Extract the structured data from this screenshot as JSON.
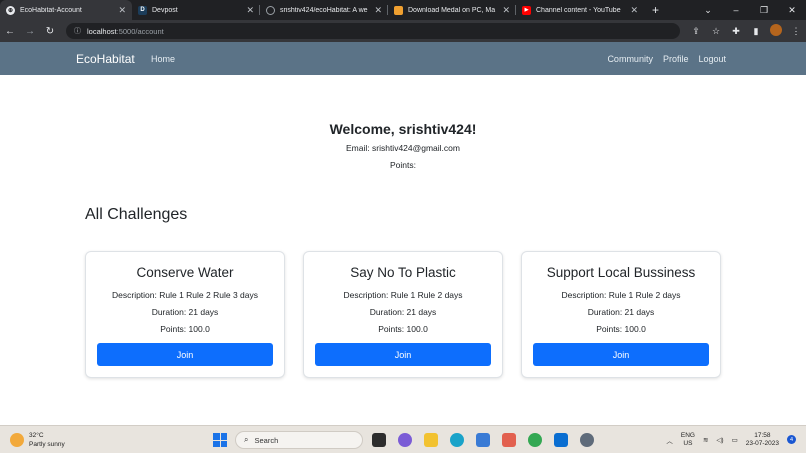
{
  "browser": {
    "tabs": [
      {
        "title": "EcoHabitat-Account",
        "active": true,
        "icon": "globe-icon"
      },
      {
        "title": "Devpost",
        "active": false,
        "icon": "devpost-icon"
      },
      {
        "title": "srishtiv424/ecoHabitat: A we",
        "active": false,
        "icon": "github-icon"
      },
      {
        "title": "Download Medal on PC, Ma",
        "active": false,
        "icon": "medal-icon"
      },
      {
        "title": "Channel content - YouTube",
        "active": false,
        "icon": "youtube-icon"
      }
    ],
    "new_tab": "+",
    "address": {
      "host": "localhost",
      "path": ":5000/account"
    }
  },
  "navbar": {
    "brand": "EcoHabitat",
    "home": "Home",
    "community": "Community",
    "profile": "Profile",
    "logout": "Logout"
  },
  "profile": {
    "welcome": "Welcome, srishtiv424!",
    "email": "Email: srishtiv424@gmail.com",
    "points": "Points:"
  },
  "section_title": "All Challenges",
  "challenges": [
    {
      "title": "Conserve Water",
      "description": "Description: Rule 1 Rule 2 Rule 3 days",
      "duration": "Duration: 21 days",
      "points": "Points: 100.0",
      "button": "Join"
    },
    {
      "title": "Say No To Plastic",
      "description": "Description: Rule 1 Rule 2 days",
      "duration": "Duration: 21 days",
      "points": "Points: 100.0",
      "button": "Join"
    },
    {
      "title": "Support Local Bussiness",
      "description": "Description: Rule 1 Rule 2 days",
      "duration": "Duration: 21 days",
      "points": "Points: 100.0",
      "button": "Join"
    }
  ],
  "taskbar": {
    "weather_temp": "32°C",
    "weather_desc": "Partly sunny",
    "search": "Search",
    "lang_top": "ENG",
    "lang_bottom": "US",
    "time": "17:58",
    "date": "23-07-2023",
    "notif_count": "4"
  },
  "colors": {
    "navbar": "#5b7387",
    "primary_button": "#0d6efd",
    "chrome_dark": "#202124"
  }
}
